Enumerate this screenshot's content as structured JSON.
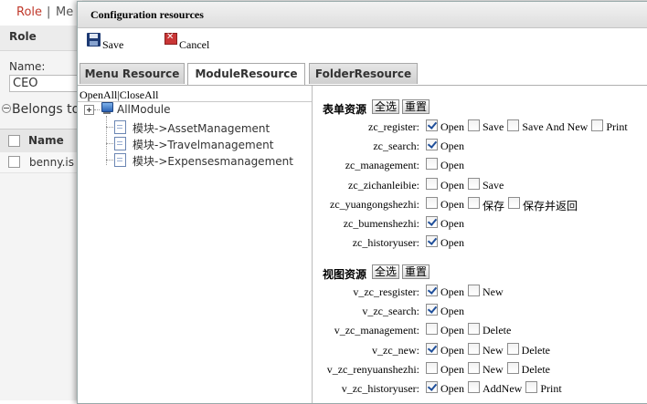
{
  "background": {
    "nav": {
      "role": "Role",
      "separator": "|",
      "menu": "Me"
    },
    "role_header": "Role",
    "name_label": "Name:",
    "name_value": "CEO",
    "belongs_to": "Belongs to",
    "table": {
      "column_name": "Name",
      "rows": [
        "benny.is"
      ]
    }
  },
  "modal": {
    "title": "Configuration resources",
    "toolbar": {
      "save_label": "Save",
      "cancel_label": "Cancel"
    },
    "tabs": [
      {
        "label": "Menu Resource",
        "active": false
      },
      {
        "label": "ModuleResource",
        "active": true
      },
      {
        "label": "FolderResource",
        "active": false
      }
    ],
    "tree": {
      "open_all": "OpenAll",
      "separator": "|",
      "close_all": "CloseAll",
      "root_label": "AllModule",
      "children": [
        "模块->AssetManagement",
        "模块->Travelmanagement",
        "模块->Expensesmanagement"
      ]
    },
    "form_section": {
      "title": "表单资源",
      "select_all": "全选",
      "reset": "重置",
      "rows": [
        {
          "label": "zc_register:",
          "options": [
            {
              "label": "Open",
              "checked": true
            },
            {
              "label": "Save",
              "checked": false
            },
            {
              "label": "Save And New",
              "checked": false
            },
            {
              "label": "Print",
              "checked": false
            }
          ]
        },
        {
          "label": "zc_search:",
          "options": [
            {
              "label": "Open",
              "checked": true
            }
          ]
        },
        {
          "label": "zc_management:",
          "options": [
            {
              "label": "Open",
              "checked": false
            }
          ]
        },
        {
          "label": "zc_zichanleibie:",
          "options": [
            {
              "label": "Open",
              "checked": false
            },
            {
              "label": "Save",
              "checked": false
            }
          ]
        },
        {
          "label": "zc_yuangongshezhi:",
          "options": [
            {
              "label": "Open",
              "checked": false
            },
            {
              "label": "保存",
              "checked": false
            },
            {
              "label": "保存并返回",
              "checked": false
            }
          ]
        },
        {
          "label": "zc_bumenshezhi:",
          "options": [
            {
              "label": "Open",
              "checked": true
            }
          ]
        },
        {
          "label": "zc_historyuser:",
          "options": [
            {
              "label": "Open",
              "checked": true
            }
          ]
        }
      ]
    },
    "view_section": {
      "title": "视图资源",
      "select_all": "全选",
      "reset": "重置",
      "rows": [
        {
          "label": "v_zc_resgister:",
          "options": [
            {
              "label": "Open",
              "checked": true
            },
            {
              "label": "New",
              "checked": false
            }
          ]
        },
        {
          "label": "v_zc_search:",
          "options": [
            {
              "label": "Open",
              "checked": true
            }
          ]
        },
        {
          "label": "v_zc_management:",
          "options": [
            {
              "label": "Open",
              "checked": false
            },
            {
              "label": "Delete",
              "checked": false
            }
          ]
        },
        {
          "label": "v_zc_new:",
          "options": [
            {
              "label": "Open",
              "checked": true
            },
            {
              "label": "New",
              "checked": false
            },
            {
              "label": "Delete",
              "checked": false
            }
          ]
        },
        {
          "label": "v_zc_renyuanshezhi:",
          "options": [
            {
              "label": "Open",
              "checked": false
            },
            {
              "label": "New",
              "checked": false
            },
            {
              "label": "Delete",
              "checked": false
            }
          ]
        },
        {
          "label": "v_zc_historyuser:",
          "options": [
            {
              "label": "Open",
              "checked": true
            },
            {
              "label": "AddNew",
              "checked": false
            },
            {
              "label": "Print",
              "checked": false
            }
          ]
        }
      ]
    }
  }
}
